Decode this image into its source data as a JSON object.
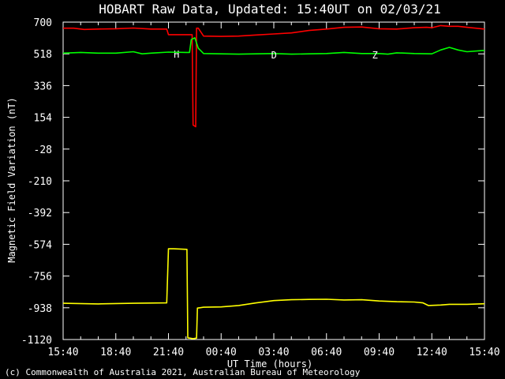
{
  "chart_data": {
    "type": "line",
    "title": "HOBART Raw Data, Updated: 15:40UT on 02/03/21",
    "xlabel": "UT Time (hours)",
    "ylabel": "Magnetic Field Variation (nT)",
    "copyright": "(c) Commonwealth of Australia 2021, Australian Bureau of Meteorology",
    "x_ticks": [
      "15:40",
      "18:40",
      "21:40",
      "00:40",
      "03:40",
      "06:40",
      "09:40",
      "12:40",
      "15:40"
    ],
    "y_ticks": [
      "700",
      "518",
      "336",
      "154",
      "-28",
      "-210",
      "-392",
      "-574",
      "-756",
      "-938",
      "-1120"
    ],
    "xlim": [
      0,
      24
    ],
    "ylim": [
      -1120,
      700
    ],
    "background": "#000000",
    "axis_color": "#ffffff",
    "series": [
      {
        "name": "H",
        "color": "#ff0000",
        "label_at": [
          6.3,
          518
        ],
        "points": [
          [
            0,
            665
          ],
          [
            0.6,
            665
          ],
          [
            1.2,
            658
          ],
          [
            2,
            660
          ],
          [
            3,
            662
          ],
          [
            4,
            666
          ],
          [
            5,
            660
          ],
          [
            5.9,
            660
          ],
          [
            6.0,
            628
          ],
          [
            7.0,
            628
          ],
          [
            7.35,
            628
          ],
          [
            7.4,
            110
          ],
          [
            7.55,
            100
          ],
          [
            7.6,
            665
          ],
          [
            7.7,
            665
          ],
          [
            8,
            620
          ],
          [
            9,
            618
          ],
          [
            10,
            620
          ],
          [
            11,
            626
          ],
          [
            12,
            632
          ],
          [
            13,
            638
          ],
          [
            14,
            652
          ],
          [
            15,
            660
          ],
          [
            16,
            670
          ],
          [
            17,
            672
          ],
          [
            18,
            662
          ],
          [
            19,
            660
          ],
          [
            20,
            668
          ],
          [
            20.7,
            670
          ],
          [
            21,
            668
          ],
          [
            21.5,
            680
          ],
          [
            22,
            676
          ],
          [
            22.5,
            676
          ],
          [
            23,
            670
          ],
          [
            24,
            660
          ]
        ]
      },
      {
        "name": "D",
        "color": "#00ff00",
        "label_at": [
          11.85,
          515
        ],
        "points": [
          [
            0,
            522
          ],
          [
            1,
            526
          ],
          [
            2,
            522
          ],
          [
            3,
            522
          ],
          [
            4,
            530
          ],
          [
            4.5,
            518
          ],
          [
            5,
            522
          ],
          [
            6,
            528
          ],
          [
            7,
            526
          ],
          [
            7.2,
            526
          ],
          [
            7.3,
            600
          ],
          [
            7.5,
            610
          ],
          [
            7.7,
            550
          ],
          [
            8,
            520
          ],
          [
            9,
            518
          ],
          [
            10,
            516
          ],
          [
            11,
            518
          ],
          [
            12,
            520
          ],
          [
            13,
            516
          ],
          [
            14,
            518
          ],
          [
            15,
            520
          ],
          [
            16,
            526
          ],
          [
            17,
            520
          ],
          [
            18,
            520
          ],
          [
            18.5,
            516
          ],
          [
            19,
            524
          ],
          [
            20,
            520
          ],
          [
            21,
            518
          ],
          [
            21.5,
            540
          ],
          [
            22,
            555
          ],
          [
            22.5,
            540
          ],
          [
            23,
            530
          ],
          [
            24,
            538
          ]
        ]
      },
      {
        "name": "Z",
        "color": "#ffff00",
        "label_at": [
          17.6,
          515
        ],
        "points": [
          [
            0,
            -912
          ],
          [
            2,
            -916
          ],
          [
            4,
            -912
          ],
          [
            5.9,
            -910
          ],
          [
            6,
            -600
          ],
          [
            6.3,
            -600
          ],
          [
            7.05,
            -603
          ],
          [
            7.1,
            -1110
          ],
          [
            7.4,
            -1115
          ],
          [
            7.6,
            -1112
          ],
          [
            7.65,
            -940
          ],
          [
            8,
            -935
          ],
          [
            9,
            -933
          ],
          [
            10,
            -925
          ],
          [
            11,
            -910
          ],
          [
            12,
            -897
          ],
          [
            13,
            -892
          ],
          [
            14,
            -890
          ],
          [
            15,
            -889
          ],
          [
            16,
            -893
          ],
          [
            17,
            -892
          ],
          [
            18,
            -899
          ],
          [
            19,
            -903
          ],
          [
            20,
            -905
          ],
          [
            20.5,
            -910
          ],
          [
            20.8,
            -925
          ],
          [
            21.5,
            -922
          ],
          [
            22,
            -918
          ],
          [
            23,
            -918
          ],
          [
            24,
            -915
          ]
        ]
      }
    ]
  }
}
